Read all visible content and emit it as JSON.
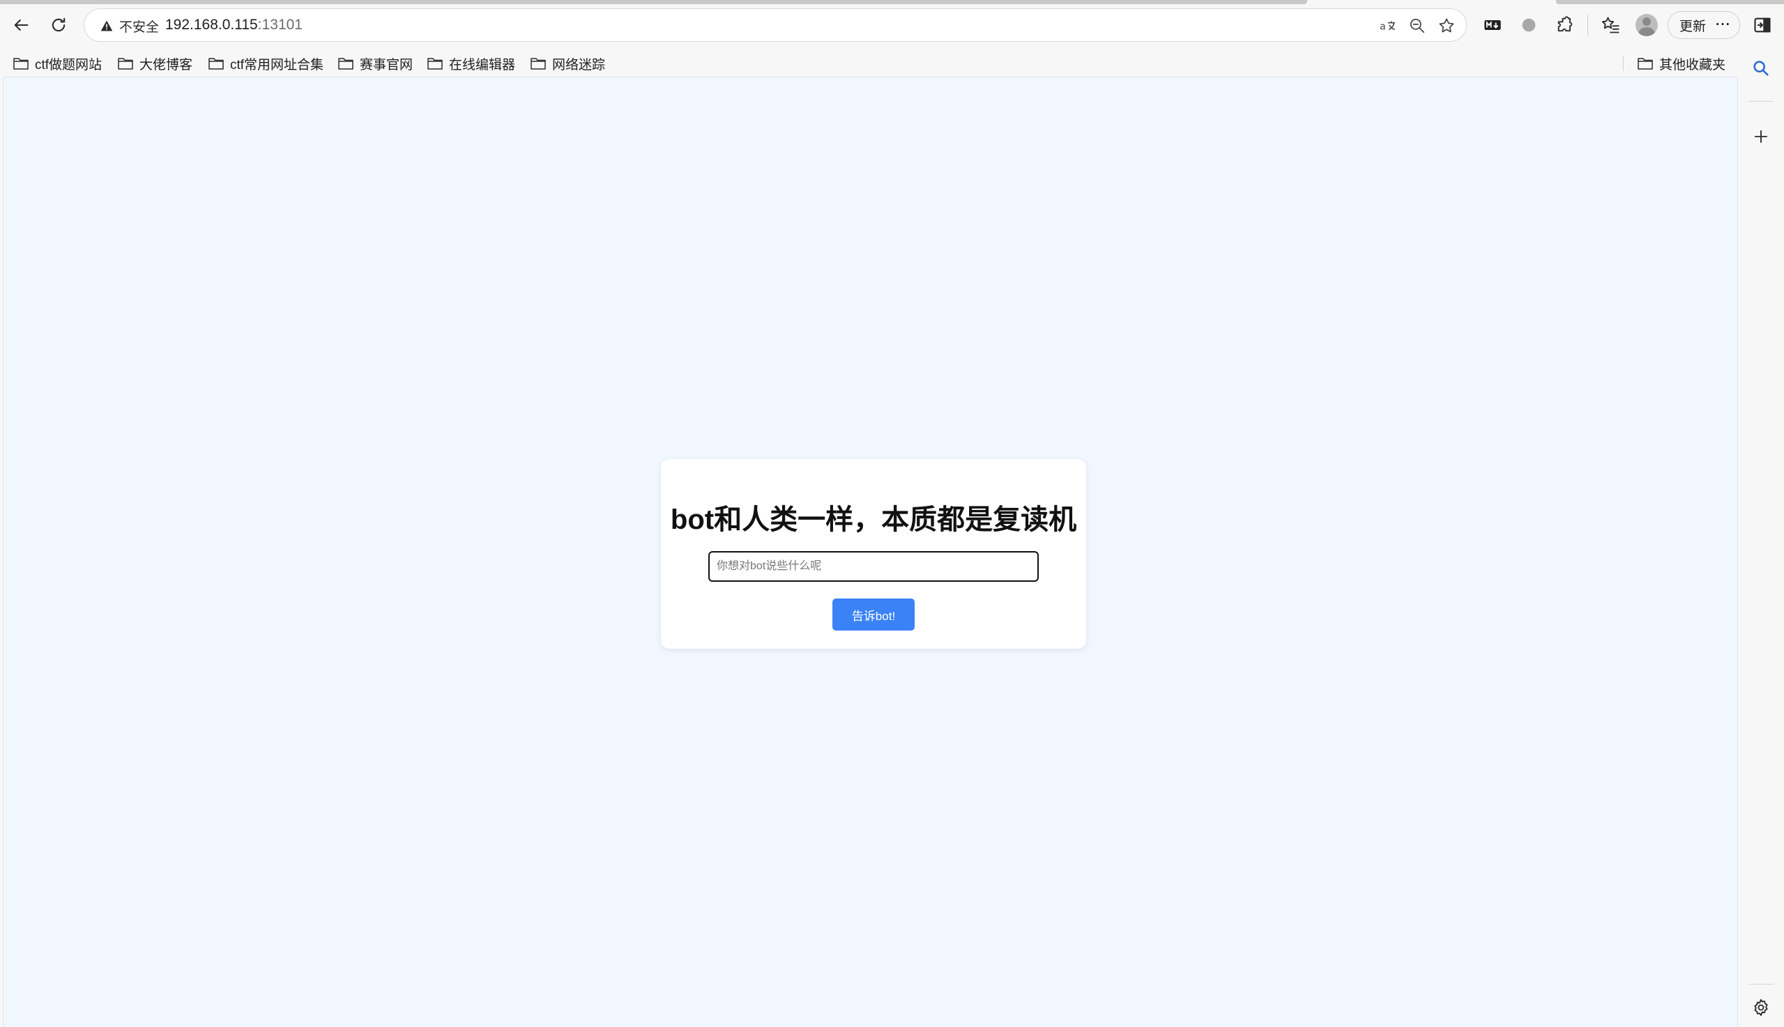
{
  "browser": {
    "security_label": "不安全",
    "url_host": "192.168.0.115",
    "url_port": ":13101",
    "update_label": "更新",
    "more_label": "···"
  },
  "bookmarks": {
    "items": [
      {
        "label": "ctf做题网站"
      },
      {
        "label": "大佬博客"
      },
      {
        "label": "ctf常用网址合集"
      },
      {
        "label": "赛事官网"
      },
      {
        "label": "在线编辑器"
      },
      {
        "label": "网络迷踪"
      }
    ],
    "other_label": "其他收藏夹"
  },
  "page": {
    "title": "bot和人类一样，本质都是复读机",
    "input_placeholder": "你想对bot说些什么呢",
    "input_value": "",
    "button_label": "告诉bot!"
  },
  "colors": {
    "page_background": "#f0f7fe",
    "button": "#3b82f6"
  }
}
